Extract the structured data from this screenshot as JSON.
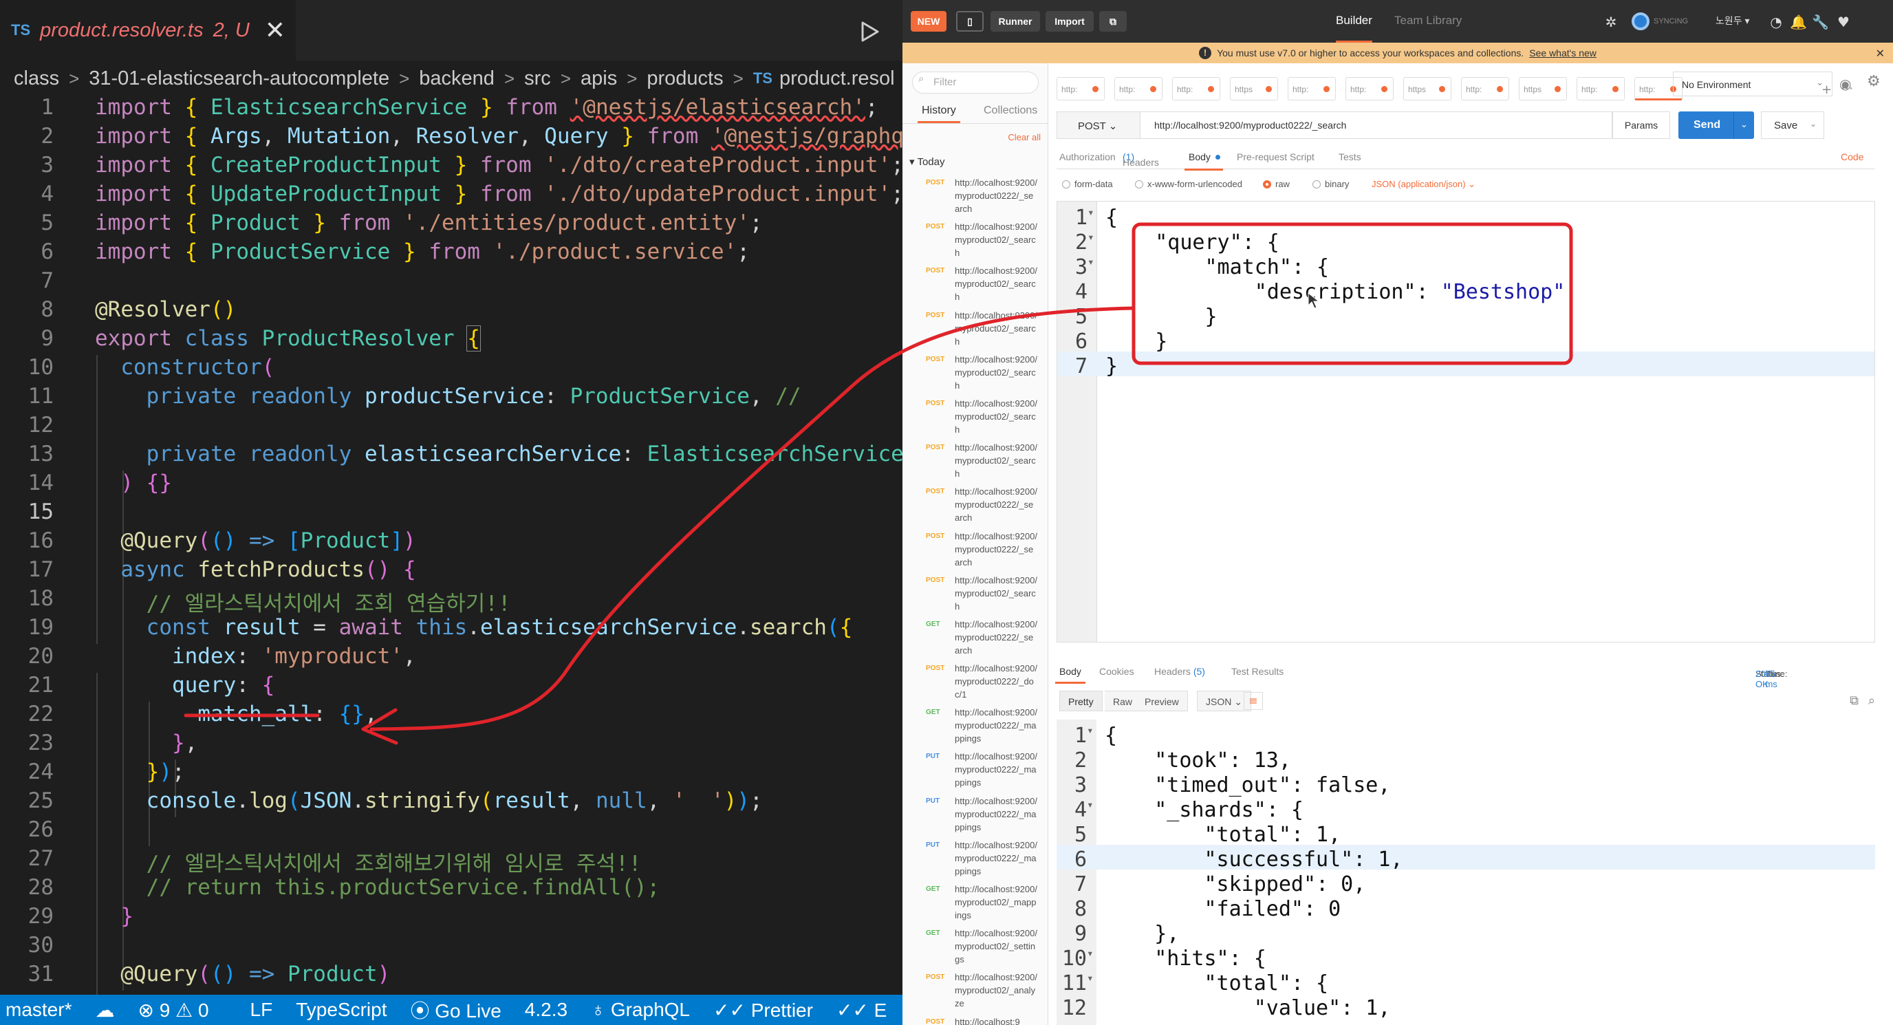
{
  "vscode": {
    "tab": {
      "lang_badge": "TS",
      "filename": "product.resolver.ts",
      "status": "2, U",
      "close_glyph": "✕"
    },
    "breadcrumb": [
      "class",
      "31-01-elasticsearch-autocomplete",
      "backend",
      "src",
      "apis",
      "products"
    ],
    "breadcrumb_file_badge": "TS",
    "breadcrumb_file": "product.resol",
    "current_line": 15,
    "status_bar": {
      "branch": "master*",
      "sync_icon": "cloud-upload-icon",
      "problems": "⊗ 9 ⚠ 0",
      "eol": "LF",
      "language": "TypeScript",
      "live": "Go Live",
      "version": "4.2.3",
      "graphql": "GraphQL",
      "prettier": "Prettier",
      "trailing": "E"
    }
  },
  "postman": {
    "header": {
      "new_label": "NEW",
      "runner_label": "Runner",
      "import_label": "Import",
      "builder_tab": "Builder",
      "team_tab": "Team Library",
      "sync_label": "SYNCING",
      "user_name": "노원두"
    },
    "banner": {
      "text": "You must use v7.0 or higher to access your workspaces and collections.",
      "link": "See what's new"
    },
    "sidebar": {
      "filter_placeholder": "Filter",
      "tabs": [
        "History",
        "Collections"
      ],
      "clear_all": "Clear all",
      "group": "Today",
      "history": [
        {
          "method": "POST",
          "url": "http://localhost:9200/myproduct0222/_search"
        },
        {
          "method": "POST",
          "url": "http://localhost:9200/myproduct02/_search"
        },
        {
          "method": "POST",
          "url": "http://localhost:9200/myproduct02/_search"
        },
        {
          "method": "POST",
          "url": "http://localhost:9200/myproduct02/_search"
        },
        {
          "method": "POST",
          "url": "http://localhost:9200/myproduct02/_search"
        },
        {
          "method": "POST",
          "url": "http://localhost:9200/myproduct02/_search"
        },
        {
          "method": "POST",
          "url": "http://localhost:9200/myproduct02/_search"
        },
        {
          "method": "POST",
          "url": "http://localhost:9200/myproduct0222/_search"
        },
        {
          "method": "POST",
          "url": "http://localhost:9200/myproduct0222/_search"
        },
        {
          "method": "POST",
          "url": "http://localhost:9200/myproduct02/_search"
        },
        {
          "method": "GET",
          "url": "http://localhost:9200/myproduct0222/_search"
        },
        {
          "method": "POST",
          "url": "http://localhost:9200/myproduct0222/_doc/1"
        },
        {
          "method": "GET",
          "url": "http://localhost:9200/myproduct0222/_mappings"
        },
        {
          "method": "PUT",
          "url": "http://localhost:9200/myproduct0222/_mappings"
        },
        {
          "method": "PUT",
          "url": "http://localhost:9200/myproduct0222/_mappings"
        },
        {
          "method": "PUT",
          "url": "http://localhost:9200/myproduct0222/_mappings"
        },
        {
          "method": "GET",
          "url": "http://localhost:9200/myproduct02/_mappings"
        },
        {
          "method": "GET",
          "url": "http://localhost:9200/myproduct02/_settings"
        },
        {
          "method": "POST",
          "url": "http://localhost:9200/myproduct02/_analyze"
        },
        {
          "method": "POST",
          "url": "http://localhost:9"
        }
      ]
    },
    "request_tabs": [
      "http:",
      "http:",
      "http:",
      "https",
      "http:",
      "http:",
      "https",
      "http:",
      "https",
      "http:",
      "http:"
    ],
    "environment": "No Environment",
    "request": {
      "method": "POST",
      "url": "http://localhost:9200/myproduct0222/_search",
      "params_label": "Params",
      "send_label": "Send",
      "save_label": "Save",
      "sub_tabs": {
        "authorization": "Authorization",
        "headers": "Headers",
        "headers_count": "(1)",
        "body": "Body",
        "prerequest": "Pre-request Script",
        "tests": "Tests",
        "code": "Code"
      },
      "body_options": [
        "form-data",
        "x-www-form-urlencoded",
        "raw",
        "binary"
      ],
      "body_type": "JSON (application/json)"
    },
    "response": {
      "tabs": {
        "body": "Body",
        "cookies": "Cookies",
        "headers": "Headers",
        "headers_count": "(5)",
        "test_results": "Test Results"
      },
      "status_label": "Status:",
      "status_value": "200 OK",
      "time_label": "Time:",
      "time_value": "35 ms",
      "view_options": [
        "Pretty",
        "Raw",
        "Preview"
      ],
      "format": "JSON"
    }
  }
}
